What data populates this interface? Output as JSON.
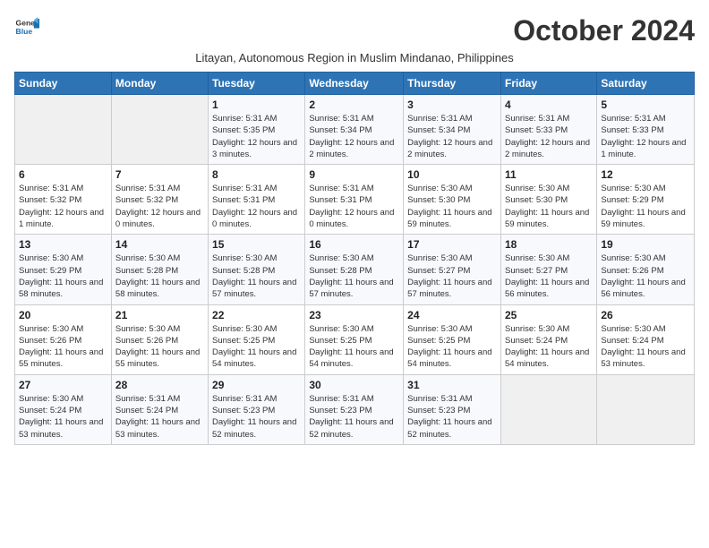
{
  "logo": {
    "line1": "General",
    "line2": "Blue"
  },
  "title": "October 2024",
  "subtitle": "Litayan, Autonomous Region in Muslim Mindanao, Philippines",
  "days_header": [
    "Sunday",
    "Monday",
    "Tuesday",
    "Wednesday",
    "Thursday",
    "Friday",
    "Saturday"
  ],
  "weeks": [
    [
      {
        "day": "",
        "info": ""
      },
      {
        "day": "",
        "info": ""
      },
      {
        "day": "1",
        "info": "Sunrise: 5:31 AM\nSunset: 5:35 PM\nDaylight: 12 hours and 3 minutes."
      },
      {
        "day": "2",
        "info": "Sunrise: 5:31 AM\nSunset: 5:34 PM\nDaylight: 12 hours and 2 minutes."
      },
      {
        "day": "3",
        "info": "Sunrise: 5:31 AM\nSunset: 5:34 PM\nDaylight: 12 hours and 2 minutes."
      },
      {
        "day": "4",
        "info": "Sunrise: 5:31 AM\nSunset: 5:33 PM\nDaylight: 12 hours and 2 minutes."
      },
      {
        "day": "5",
        "info": "Sunrise: 5:31 AM\nSunset: 5:33 PM\nDaylight: 12 hours and 1 minute."
      }
    ],
    [
      {
        "day": "6",
        "info": "Sunrise: 5:31 AM\nSunset: 5:32 PM\nDaylight: 12 hours and 1 minute."
      },
      {
        "day": "7",
        "info": "Sunrise: 5:31 AM\nSunset: 5:32 PM\nDaylight: 12 hours and 0 minutes."
      },
      {
        "day": "8",
        "info": "Sunrise: 5:31 AM\nSunset: 5:31 PM\nDaylight: 12 hours and 0 minutes."
      },
      {
        "day": "9",
        "info": "Sunrise: 5:31 AM\nSunset: 5:31 PM\nDaylight: 12 hours and 0 minutes."
      },
      {
        "day": "10",
        "info": "Sunrise: 5:30 AM\nSunset: 5:30 PM\nDaylight: 11 hours and 59 minutes."
      },
      {
        "day": "11",
        "info": "Sunrise: 5:30 AM\nSunset: 5:30 PM\nDaylight: 11 hours and 59 minutes."
      },
      {
        "day": "12",
        "info": "Sunrise: 5:30 AM\nSunset: 5:29 PM\nDaylight: 11 hours and 59 minutes."
      }
    ],
    [
      {
        "day": "13",
        "info": "Sunrise: 5:30 AM\nSunset: 5:29 PM\nDaylight: 11 hours and 58 minutes."
      },
      {
        "day": "14",
        "info": "Sunrise: 5:30 AM\nSunset: 5:28 PM\nDaylight: 11 hours and 58 minutes."
      },
      {
        "day": "15",
        "info": "Sunrise: 5:30 AM\nSunset: 5:28 PM\nDaylight: 11 hours and 57 minutes."
      },
      {
        "day": "16",
        "info": "Sunrise: 5:30 AM\nSunset: 5:28 PM\nDaylight: 11 hours and 57 minutes."
      },
      {
        "day": "17",
        "info": "Sunrise: 5:30 AM\nSunset: 5:27 PM\nDaylight: 11 hours and 57 minutes."
      },
      {
        "day": "18",
        "info": "Sunrise: 5:30 AM\nSunset: 5:27 PM\nDaylight: 11 hours and 56 minutes."
      },
      {
        "day": "19",
        "info": "Sunrise: 5:30 AM\nSunset: 5:26 PM\nDaylight: 11 hours and 56 minutes."
      }
    ],
    [
      {
        "day": "20",
        "info": "Sunrise: 5:30 AM\nSunset: 5:26 PM\nDaylight: 11 hours and 55 minutes."
      },
      {
        "day": "21",
        "info": "Sunrise: 5:30 AM\nSunset: 5:26 PM\nDaylight: 11 hours and 55 minutes."
      },
      {
        "day": "22",
        "info": "Sunrise: 5:30 AM\nSunset: 5:25 PM\nDaylight: 11 hours and 54 minutes."
      },
      {
        "day": "23",
        "info": "Sunrise: 5:30 AM\nSunset: 5:25 PM\nDaylight: 11 hours and 54 minutes."
      },
      {
        "day": "24",
        "info": "Sunrise: 5:30 AM\nSunset: 5:25 PM\nDaylight: 11 hours and 54 minutes."
      },
      {
        "day": "25",
        "info": "Sunrise: 5:30 AM\nSunset: 5:24 PM\nDaylight: 11 hours and 54 minutes."
      },
      {
        "day": "26",
        "info": "Sunrise: 5:30 AM\nSunset: 5:24 PM\nDaylight: 11 hours and 53 minutes."
      }
    ],
    [
      {
        "day": "27",
        "info": "Sunrise: 5:30 AM\nSunset: 5:24 PM\nDaylight: 11 hours and 53 minutes."
      },
      {
        "day": "28",
        "info": "Sunrise: 5:31 AM\nSunset: 5:24 PM\nDaylight: 11 hours and 53 minutes."
      },
      {
        "day": "29",
        "info": "Sunrise: 5:31 AM\nSunset: 5:23 PM\nDaylight: 11 hours and 52 minutes."
      },
      {
        "day": "30",
        "info": "Sunrise: 5:31 AM\nSunset: 5:23 PM\nDaylight: 11 hours and 52 minutes."
      },
      {
        "day": "31",
        "info": "Sunrise: 5:31 AM\nSunset: 5:23 PM\nDaylight: 11 hours and 52 minutes."
      },
      {
        "day": "",
        "info": ""
      },
      {
        "day": "",
        "info": ""
      }
    ]
  ]
}
